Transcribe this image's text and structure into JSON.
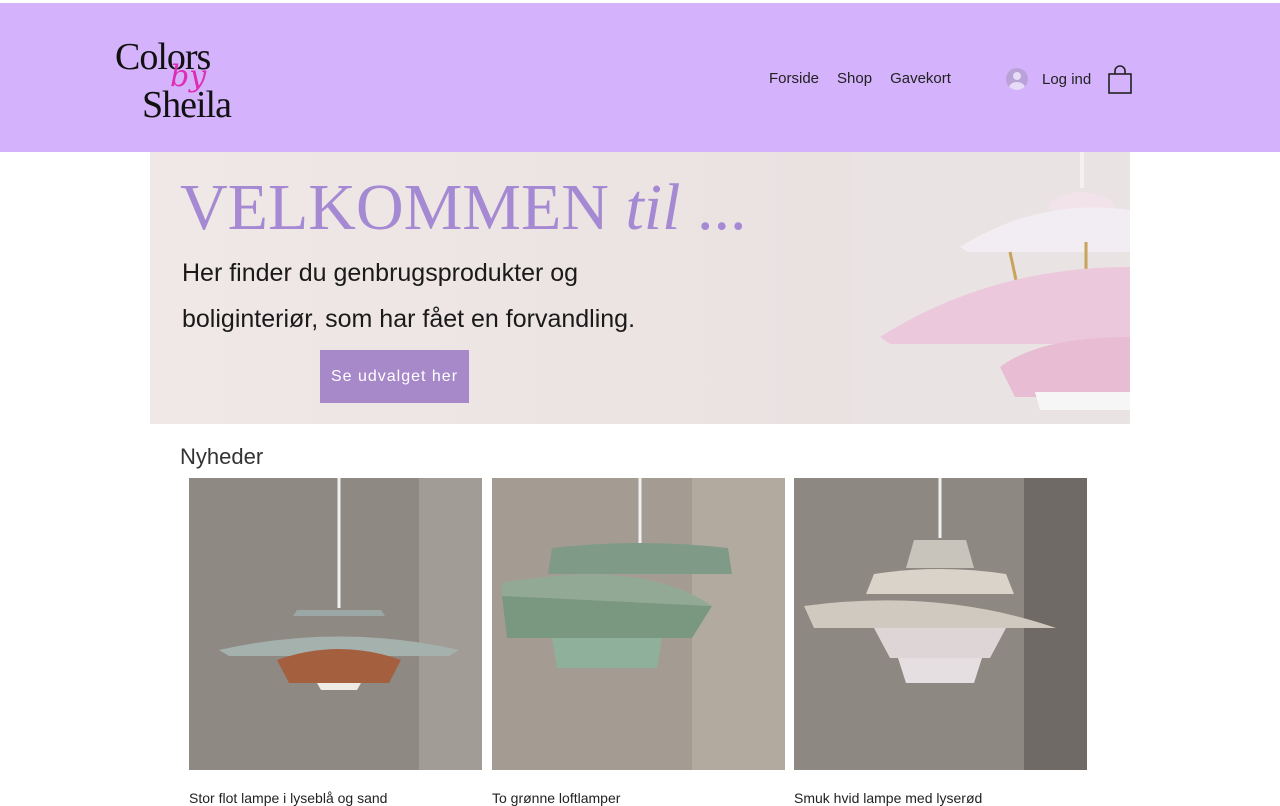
{
  "brand": {
    "logo_line1": "Colors",
    "logo_line2": "by",
    "logo_line3": "Sheila"
  },
  "nav": {
    "items": [
      {
        "label": "Forside"
      },
      {
        "label": "Shop"
      },
      {
        "label": "Gavekort"
      }
    ],
    "login_label": "Log ind",
    "cart_icon": "shopping-bag-icon"
  },
  "hero": {
    "title_main": "VELKOMMEN",
    "title_italic": "til",
    "title_tail": "...",
    "subtitle_line1": "Her finder du genbrugsprodukter og",
    "subtitle_line2": "boliginteriør, som har fået en forvandling.",
    "cta_label": "Se udvalget her"
  },
  "section": {
    "title": "Nyheder"
  },
  "products": [
    {
      "name": "Stor flot lampe i lyseblå og sand"
    },
    {
      "name": "To grønne loftlamper"
    },
    {
      "name": "Smuk hvid lampe med lyserød"
    }
  ],
  "colors": {
    "header_bg": "#d4b2fc",
    "accent": "#a788c9",
    "title_purple": "#a58ad3",
    "logo_pink": "#e02bb5"
  }
}
